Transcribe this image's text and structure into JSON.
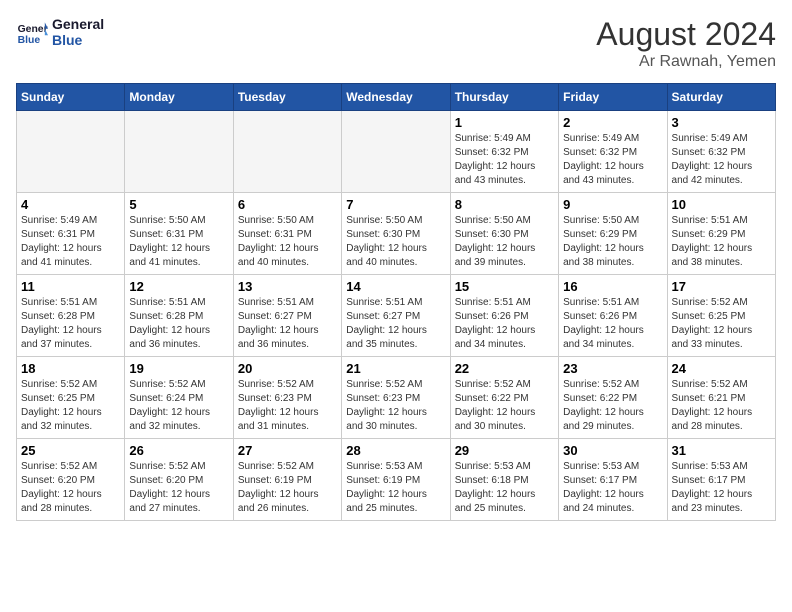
{
  "header": {
    "logo_line1": "General",
    "logo_line2": "Blue",
    "month_year": "August 2024",
    "location": "Ar Rawnah, Yemen"
  },
  "days_of_week": [
    "Sunday",
    "Monday",
    "Tuesday",
    "Wednesday",
    "Thursday",
    "Friday",
    "Saturday"
  ],
  "weeks": [
    [
      {
        "num": "",
        "info": ""
      },
      {
        "num": "",
        "info": ""
      },
      {
        "num": "",
        "info": ""
      },
      {
        "num": "",
        "info": ""
      },
      {
        "num": "1",
        "info": "Sunrise: 5:49 AM\nSunset: 6:32 PM\nDaylight: 12 hours\nand 43 minutes."
      },
      {
        "num": "2",
        "info": "Sunrise: 5:49 AM\nSunset: 6:32 PM\nDaylight: 12 hours\nand 43 minutes."
      },
      {
        "num": "3",
        "info": "Sunrise: 5:49 AM\nSunset: 6:32 PM\nDaylight: 12 hours\nand 42 minutes."
      }
    ],
    [
      {
        "num": "4",
        "info": "Sunrise: 5:49 AM\nSunset: 6:31 PM\nDaylight: 12 hours\nand 41 minutes."
      },
      {
        "num": "5",
        "info": "Sunrise: 5:50 AM\nSunset: 6:31 PM\nDaylight: 12 hours\nand 41 minutes."
      },
      {
        "num": "6",
        "info": "Sunrise: 5:50 AM\nSunset: 6:31 PM\nDaylight: 12 hours\nand 40 minutes."
      },
      {
        "num": "7",
        "info": "Sunrise: 5:50 AM\nSunset: 6:30 PM\nDaylight: 12 hours\nand 40 minutes."
      },
      {
        "num": "8",
        "info": "Sunrise: 5:50 AM\nSunset: 6:30 PM\nDaylight: 12 hours\nand 39 minutes."
      },
      {
        "num": "9",
        "info": "Sunrise: 5:50 AM\nSunset: 6:29 PM\nDaylight: 12 hours\nand 38 minutes."
      },
      {
        "num": "10",
        "info": "Sunrise: 5:51 AM\nSunset: 6:29 PM\nDaylight: 12 hours\nand 38 minutes."
      }
    ],
    [
      {
        "num": "11",
        "info": "Sunrise: 5:51 AM\nSunset: 6:28 PM\nDaylight: 12 hours\nand 37 minutes."
      },
      {
        "num": "12",
        "info": "Sunrise: 5:51 AM\nSunset: 6:28 PM\nDaylight: 12 hours\nand 36 minutes."
      },
      {
        "num": "13",
        "info": "Sunrise: 5:51 AM\nSunset: 6:27 PM\nDaylight: 12 hours\nand 36 minutes."
      },
      {
        "num": "14",
        "info": "Sunrise: 5:51 AM\nSunset: 6:27 PM\nDaylight: 12 hours\nand 35 minutes."
      },
      {
        "num": "15",
        "info": "Sunrise: 5:51 AM\nSunset: 6:26 PM\nDaylight: 12 hours\nand 34 minutes."
      },
      {
        "num": "16",
        "info": "Sunrise: 5:51 AM\nSunset: 6:26 PM\nDaylight: 12 hours\nand 34 minutes."
      },
      {
        "num": "17",
        "info": "Sunrise: 5:52 AM\nSunset: 6:25 PM\nDaylight: 12 hours\nand 33 minutes."
      }
    ],
    [
      {
        "num": "18",
        "info": "Sunrise: 5:52 AM\nSunset: 6:25 PM\nDaylight: 12 hours\nand 32 minutes."
      },
      {
        "num": "19",
        "info": "Sunrise: 5:52 AM\nSunset: 6:24 PM\nDaylight: 12 hours\nand 32 minutes."
      },
      {
        "num": "20",
        "info": "Sunrise: 5:52 AM\nSunset: 6:23 PM\nDaylight: 12 hours\nand 31 minutes."
      },
      {
        "num": "21",
        "info": "Sunrise: 5:52 AM\nSunset: 6:23 PM\nDaylight: 12 hours\nand 30 minutes."
      },
      {
        "num": "22",
        "info": "Sunrise: 5:52 AM\nSunset: 6:22 PM\nDaylight: 12 hours\nand 30 minutes."
      },
      {
        "num": "23",
        "info": "Sunrise: 5:52 AM\nSunset: 6:22 PM\nDaylight: 12 hours\nand 29 minutes."
      },
      {
        "num": "24",
        "info": "Sunrise: 5:52 AM\nSunset: 6:21 PM\nDaylight: 12 hours\nand 28 minutes."
      }
    ],
    [
      {
        "num": "25",
        "info": "Sunrise: 5:52 AM\nSunset: 6:20 PM\nDaylight: 12 hours\nand 28 minutes."
      },
      {
        "num": "26",
        "info": "Sunrise: 5:52 AM\nSunset: 6:20 PM\nDaylight: 12 hours\nand 27 minutes."
      },
      {
        "num": "27",
        "info": "Sunrise: 5:52 AM\nSunset: 6:19 PM\nDaylight: 12 hours\nand 26 minutes."
      },
      {
        "num": "28",
        "info": "Sunrise: 5:53 AM\nSunset: 6:19 PM\nDaylight: 12 hours\nand 25 minutes."
      },
      {
        "num": "29",
        "info": "Sunrise: 5:53 AM\nSunset: 6:18 PM\nDaylight: 12 hours\nand 25 minutes."
      },
      {
        "num": "30",
        "info": "Sunrise: 5:53 AM\nSunset: 6:17 PM\nDaylight: 12 hours\nand 24 minutes."
      },
      {
        "num": "31",
        "info": "Sunrise: 5:53 AM\nSunset: 6:17 PM\nDaylight: 12 hours\nand 23 minutes."
      }
    ]
  ]
}
